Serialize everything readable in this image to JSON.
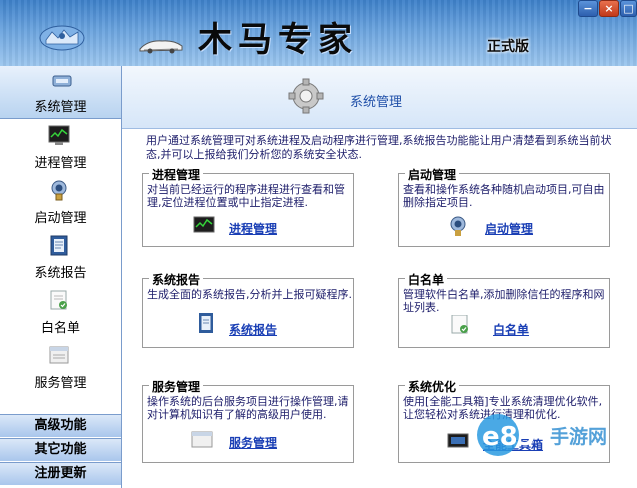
{
  "header": {
    "app_title": "木马专家",
    "edition": "正式版",
    "window_buttons": {
      "minimize": "−",
      "close": "×",
      "maximize": "□"
    },
    "colors": {
      "banner_top": "#3d80c9",
      "banner_bottom": "#9cc6ee"
    }
  },
  "sidebar": {
    "section_title": "系统管理",
    "items": [
      {
        "label": "进程管理",
        "icon": "process-monitor-icon"
      },
      {
        "label": "启动管理",
        "icon": "startup-icon"
      },
      {
        "label": "系统报告",
        "icon": "report-icon"
      },
      {
        "label": "白名单",
        "icon": "whitelist-icon"
      },
      {
        "label": "服务管理",
        "icon": "service-icon"
      }
    ],
    "groups": [
      {
        "label": "高级功能"
      },
      {
        "label": "其它功能"
      },
      {
        "label": "注册更新"
      }
    ]
  },
  "main": {
    "title": "系统管理",
    "intro": "用户通过系统管理可对系统进程及启动程序进行管理,系统报告功能能让用户清楚看到系统当前状态,并可以上报给我们分析您的系统安全状态.",
    "panels": [
      {
        "title": "进程管理",
        "desc": "对当前已经运行的程序进程进行查看和管理,定位进程位置或中止指定进程.",
        "link": "进程管理",
        "icon": "process-monitor-icon"
      },
      {
        "title": "启动管理",
        "desc": "查看和操作系统各种随机启动项目,可自由删除指定项目.",
        "link": "启动管理",
        "icon": "startup-icon"
      },
      {
        "title": "系统报告",
        "desc": "生成全面的系统报告,分析并上报可疑程序.",
        "link": "系统报告",
        "icon": "report-icon"
      },
      {
        "title": "白名单",
        "desc": "管理软件白名单,添加删除信任的程序和网址列表.",
        "link": "白名单",
        "icon": "whitelist-icon"
      },
      {
        "title": "服务管理",
        "desc": "操作系统的后台服务项目进行操作管理,请对计算机知识有了解的高级用户使用.",
        "link": "服务管理",
        "icon": "service-icon"
      },
      {
        "title": "系统优化",
        "desc": "使用[全能工具箱]专业系统清理优化软件,让您轻松对系统进行清理和优化.",
        "link": "全能工具箱",
        "icon": "toolbox-icon"
      }
    ]
  },
  "watermark": {
    "text": "e89",
    "suffix": "手游网"
  }
}
